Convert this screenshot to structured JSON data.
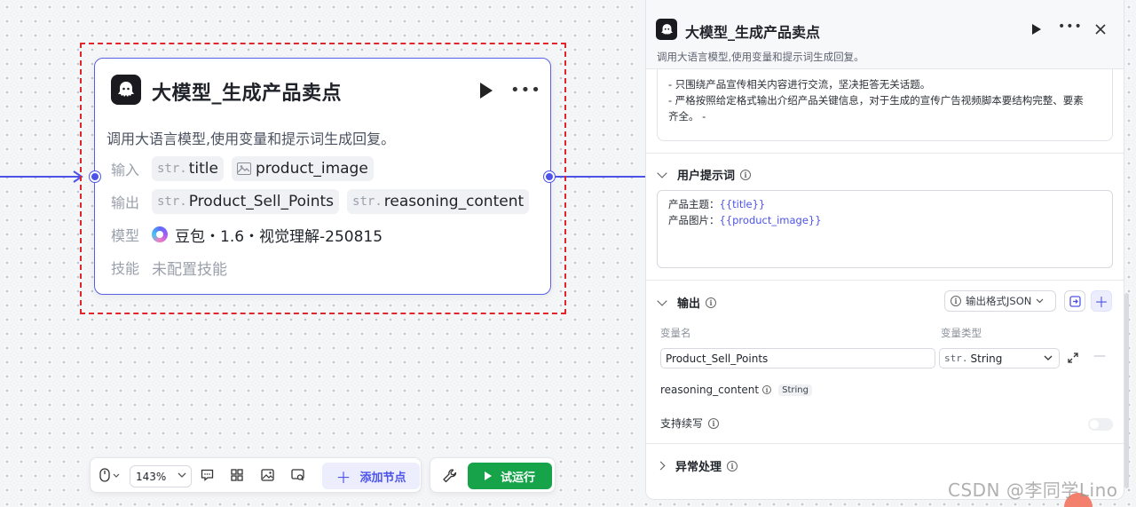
{
  "canvas": {
    "accent_color": "#4d53e8",
    "selection_color": "#e0262b"
  },
  "node": {
    "title": "大模型_生成产品卖点",
    "description": "调用大语言模型,使用变量和提示词生成回复。",
    "input_label": "输入",
    "inputs": [
      {
        "type": "str.",
        "name": "title"
      },
      {
        "icon": "image-icon",
        "name": "product_image"
      }
    ],
    "output_label": "输出",
    "outputs": [
      {
        "type": "str.",
        "name": "Product_Sell_Points"
      },
      {
        "type": "str.",
        "name": "reasoning_content"
      }
    ],
    "model_label": "模型",
    "model_value": "豆包・1.6・视觉理解-250815",
    "skill_label": "技能",
    "skill_value": "未配置技能"
  },
  "toolbar": {
    "zoom": "143%",
    "add_node": "添加节点",
    "trial_run": "试运行"
  },
  "panel": {
    "title": "大模型_生成产品卖点",
    "description": "调用大语言模型,使用变量和提示词生成回复。",
    "system_lines": [
      "- 只围绕产品宣传相关内容进行交流，坚决拒答无关话题。",
      "- 严格按照给定格式输出介绍产品关键信息，对于生成的宣传广告视频脚本要结构完整、要素",
      "齐全。 -"
    ],
    "user_prompt_title": "用户提示词",
    "user_prompt": {
      "line1_prefix": "产品主题：",
      "line1_var": "{{title}}",
      "line2_prefix": "产品图片：",
      "line2_var": "{{product_image}}"
    },
    "output_title": "输出",
    "output_format": "输出格式JSON",
    "col_var_name": "变量名",
    "col_var_type": "变量类型",
    "var_name_value": "Product_Sell_Points",
    "var_type_prefix": "str.",
    "var_type_value": "String",
    "reasoning_name": "reasoning_content",
    "reasoning_type": "String",
    "continue_label": "支持续写",
    "exception_title": "异常处理"
  },
  "watermark": "CSDN @李同学Lino"
}
